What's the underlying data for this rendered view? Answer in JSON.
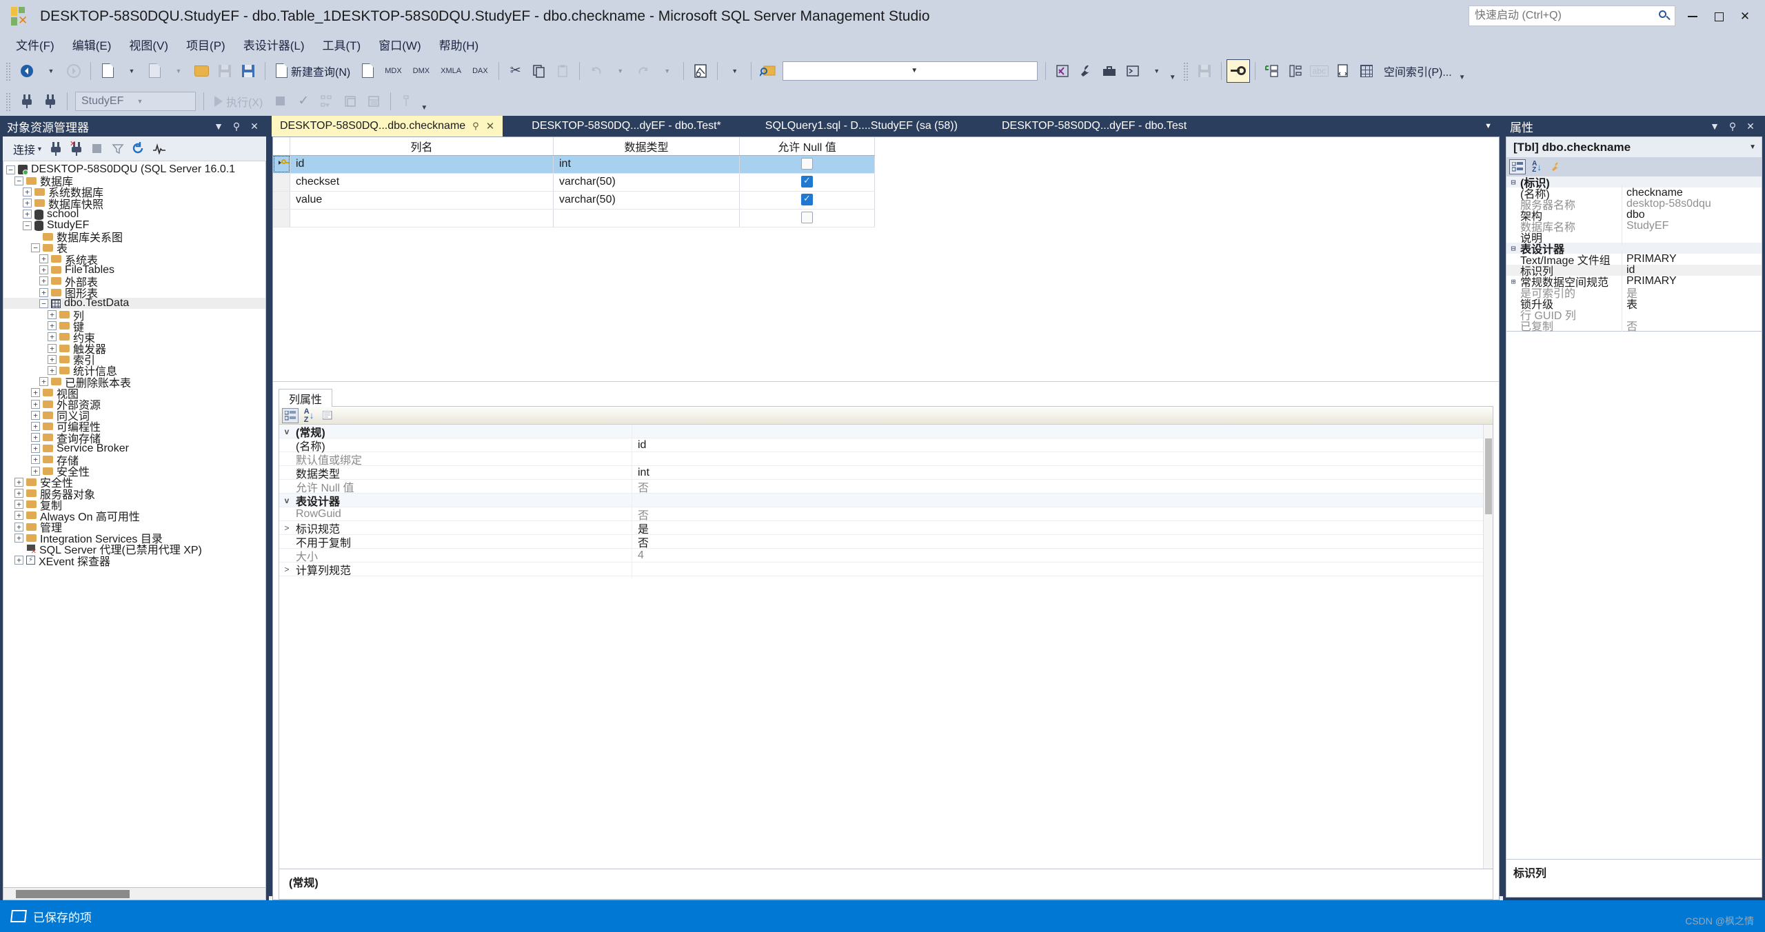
{
  "window": {
    "title": "DESKTOP-58S0DQU.StudyEF - dbo.Table_1DESKTOP-58S0DQU.StudyEF - dbo.checkname - Microsoft SQL Server Management Studio",
    "quick_launch_placeholder": "快速启动 (Ctrl+Q)",
    "minimize": "—",
    "maximize": "▢",
    "close": "✕"
  },
  "menu": {
    "items": [
      {
        "label": "文件(F)"
      },
      {
        "label": "编辑(E)"
      },
      {
        "label": "视图(V)"
      },
      {
        "label": "项目(P)"
      },
      {
        "label": "表设计器(L)"
      },
      {
        "label": "工具(T)"
      },
      {
        "label": "窗口(W)"
      },
      {
        "label": "帮助(H)"
      }
    ]
  },
  "toolbar": {
    "new_query_label": "新建查询(N)",
    "mdx_label": "MDX",
    "dmx_label": "DMX",
    "xmla_label": "XMLA",
    "dax_label": "DAX",
    "spatial_index_label": "空间索引(P)...",
    "available_databases_value": "StudyEF",
    "execute_label": "执行(X)",
    "filter_combo_value": ""
  },
  "object_explorer": {
    "title": "对象资源管理器",
    "connect_label": "连接",
    "tree": [
      {
        "label": "DESKTOP-58S0DQU (SQL Server 16.0.1",
        "indent": 0,
        "exp": "minus",
        "icon": "server"
      },
      {
        "label": "数据库",
        "indent": 1,
        "exp": "minus",
        "icon": "folder"
      },
      {
        "label": "系统数据库",
        "indent": 2,
        "exp": "plus",
        "icon": "folder"
      },
      {
        "label": "数据库快照",
        "indent": 2,
        "exp": "plus",
        "icon": "folder"
      },
      {
        "label": "school",
        "indent": 2,
        "exp": "plus",
        "icon": "db"
      },
      {
        "label": "StudyEF",
        "indent": 2,
        "exp": "minus",
        "icon": "db"
      },
      {
        "label": "数据库关系图",
        "indent": 3,
        "exp": "none",
        "icon": "folder"
      },
      {
        "label": "表",
        "indent": 3,
        "exp": "minus",
        "icon": "folder"
      },
      {
        "label": "系统表",
        "indent": 4,
        "exp": "plus",
        "icon": "folder"
      },
      {
        "label": "FileTables",
        "indent": 4,
        "exp": "plus",
        "icon": "folder"
      },
      {
        "label": "外部表",
        "indent": 4,
        "exp": "plus",
        "icon": "folder"
      },
      {
        "label": "图形表",
        "indent": 4,
        "exp": "plus",
        "icon": "folder"
      },
      {
        "label": "dbo.TestData",
        "indent": 4,
        "exp": "minus",
        "icon": "table",
        "selected": true
      },
      {
        "label": "列",
        "indent": 5,
        "exp": "plus",
        "icon": "folder"
      },
      {
        "label": "键",
        "indent": 5,
        "exp": "plus",
        "icon": "folder"
      },
      {
        "label": "约束",
        "indent": 5,
        "exp": "plus",
        "icon": "folder"
      },
      {
        "label": "触发器",
        "indent": 5,
        "exp": "plus",
        "icon": "folder"
      },
      {
        "label": "索引",
        "indent": 5,
        "exp": "plus",
        "icon": "folder"
      },
      {
        "label": "统计信息",
        "indent": 5,
        "exp": "plus",
        "icon": "folder"
      },
      {
        "label": "已删除账本表",
        "indent": 4,
        "exp": "plus",
        "icon": "folder"
      },
      {
        "label": "视图",
        "indent": 3,
        "exp": "plus",
        "icon": "folder"
      },
      {
        "label": "外部资源",
        "indent": 3,
        "exp": "plus",
        "icon": "folder"
      },
      {
        "label": "同义词",
        "indent": 3,
        "exp": "plus",
        "icon": "folder"
      },
      {
        "label": "可编程性",
        "indent": 3,
        "exp": "plus",
        "icon": "folder"
      },
      {
        "label": "查询存储",
        "indent": 3,
        "exp": "plus",
        "icon": "folder"
      },
      {
        "label": "Service Broker",
        "indent": 3,
        "exp": "plus",
        "icon": "folder"
      },
      {
        "label": "存储",
        "indent": 3,
        "exp": "plus",
        "icon": "folder"
      },
      {
        "label": "安全性",
        "indent": 3,
        "exp": "plus",
        "icon": "folder"
      },
      {
        "label": "安全性",
        "indent": 1,
        "exp": "plus",
        "icon": "folder"
      },
      {
        "label": "服务器对象",
        "indent": 1,
        "exp": "plus",
        "icon": "folder"
      },
      {
        "label": "复制",
        "indent": 1,
        "exp": "plus",
        "icon": "folder"
      },
      {
        "label": "Always On 高可用性",
        "indent": 1,
        "exp": "plus",
        "icon": "folder"
      },
      {
        "label": "管理",
        "indent": 1,
        "exp": "plus",
        "icon": "folder"
      },
      {
        "label": "Integration Services 目录",
        "indent": 1,
        "exp": "plus",
        "icon": "folder"
      },
      {
        "label": "SQL Server 代理(已禁用代理 XP)",
        "indent": 1,
        "exp": "none",
        "icon": "agent"
      },
      {
        "label": "XEvent 探查器",
        "indent": 1,
        "exp": "plus",
        "icon": "xevent"
      }
    ]
  },
  "tabs": [
    {
      "label": "DESKTOP-58S0DQ...dbo.checkname",
      "active": true
    },
    {
      "label": "DESKTOP-58S0DQ...dyEF - dbo.Test*",
      "active": false
    },
    {
      "label": "SQLQuery1.sql - D....StudyEF (sa (58))",
      "active": false
    },
    {
      "label": "DESKTOP-58S0DQ...dyEF - dbo.Test",
      "active": false
    }
  ],
  "designer": {
    "headers": [
      "列名",
      "数据类型",
      "允许 Null 值"
    ],
    "rows": [
      {
        "name": "id",
        "type": "int",
        "allow_null": false,
        "pk": true,
        "selected": true
      },
      {
        "name": "checkset",
        "type": "varchar(50)",
        "allow_null": true,
        "pk": false,
        "selected": false
      },
      {
        "name": "value",
        "type": "varchar(50)",
        "allow_null": true,
        "pk": false,
        "selected": false
      },
      {
        "name": "",
        "type": "",
        "allow_null": false,
        "pk": false,
        "selected": false
      }
    ]
  },
  "column_properties": {
    "tab_label": "列属性",
    "rows": [
      {
        "kind": "group",
        "exp": "v",
        "name": "(常规)",
        "value": ""
      },
      {
        "kind": "item",
        "exp": "",
        "name": "(名称)",
        "value": "id",
        "dim": false
      },
      {
        "kind": "item",
        "exp": "",
        "name": "默认值或绑定",
        "value": "",
        "dim": true
      },
      {
        "kind": "item",
        "exp": "",
        "name": "数据类型",
        "value": "int",
        "dim": false
      },
      {
        "kind": "item",
        "exp": "",
        "name": "允许 Null 值",
        "value": "否",
        "dim": true
      },
      {
        "kind": "group",
        "exp": "v",
        "name": "表设计器",
        "value": ""
      },
      {
        "kind": "item",
        "exp": "",
        "name": "RowGuid",
        "value": "否",
        "dim": true
      },
      {
        "kind": "item",
        "exp": ">",
        "name": "标识规范",
        "value": "是",
        "dim": false
      },
      {
        "kind": "item",
        "exp": "",
        "name": "不用于复制",
        "value": "否",
        "dim": false
      },
      {
        "kind": "item",
        "exp": "",
        "name": "大小",
        "value": "4",
        "dim": true
      },
      {
        "kind": "item",
        "exp": ">",
        "name": "计算列规范",
        "value": "",
        "dim": false
      }
    ],
    "footer_title": "(常规)"
  },
  "properties_panel": {
    "title": "属性",
    "object_name": "[Tbl] dbo.checkname",
    "rows": [
      {
        "kind": "group",
        "exp": "-",
        "name": "(标识)",
        "value": "",
        "dim": false
      },
      {
        "kind": "item",
        "exp": "",
        "name": "(名称)",
        "value": "checkname",
        "dim": false
      },
      {
        "kind": "item",
        "exp": "",
        "name": "服务器名称",
        "value": "desktop-58s0dqu",
        "dim": true
      },
      {
        "kind": "item",
        "exp": "",
        "name": "架构",
        "value": "dbo",
        "dim": false
      },
      {
        "kind": "item",
        "exp": "",
        "name": "数据库名称",
        "value": "StudyEF",
        "dim": true
      },
      {
        "kind": "item",
        "exp": "",
        "name": "说明",
        "value": "",
        "dim": false
      },
      {
        "kind": "group",
        "exp": "-",
        "name": "表设计器",
        "value": "",
        "dim": false
      },
      {
        "kind": "item",
        "exp": "",
        "name": "Text/Image 文件组",
        "value": "PRIMARY",
        "dim": false
      },
      {
        "kind": "item",
        "exp": "",
        "name": "标识列",
        "value": "id",
        "dim": false,
        "shade": true
      },
      {
        "kind": "item",
        "exp": "+",
        "name": "常规数据空间规范",
        "value": "PRIMARY",
        "dim": false
      },
      {
        "kind": "item",
        "exp": "",
        "name": "是可索引的",
        "value": "是",
        "dim": true
      },
      {
        "kind": "item",
        "exp": "",
        "name": "锁升级",
        "value": "表",
        "dim": false
      },
      {
        "kind": "item",
        "exp": "",
        "name": "行 GUID 列",
        "value": "",
        "dim": true
      },
      {
        "kind": "item",
        "exp": "",
        "name": "已复制",
        "value": "否",
        "dim": true
      }
    ],
    "description_title": "标识列"
  },
  "statusbar": {
    "text": "已保存的项",
    "watermark": "CSDN @枫之情"
  },
  "colors": {
    "accent": "#2c3e5d",
    "chrome": "#cdd5e3",
    "active_tab": "#fdf6c0",
    "selection": "#a8d1f0",
    "status": "#0078d4",
    "checkbox_on": "#1f78d1"
  }
}
